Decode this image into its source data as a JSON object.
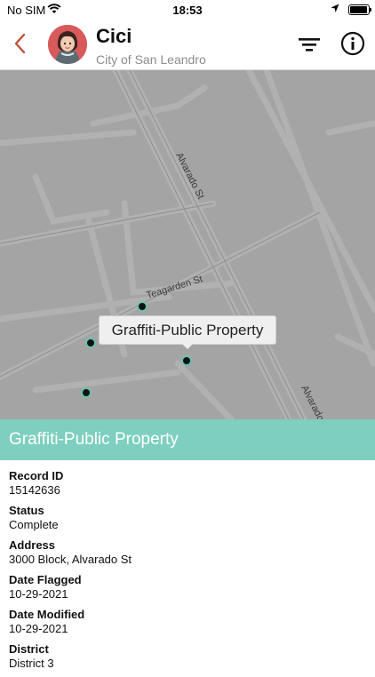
{
  "status_bar": {
    "carrier": "No SIM",
    "time": "18:53"
  },
  "header": {
    "name": "Cici",
    "organization": "City of San Leandro",
    "back_icon": "chevron-left-icon",
    "filter_icon": "filter-icon",
    "info_icon": "info-icon",
    "accent_color": "#c0503a"
  },
  "map": {
    "street_labels": [
      "Alvarado St",
      "Teagarden St",
      "Alvarado St"
    ],
    "tooltip": "Graffiti-Public Property",
    "marker_color": "#0d1513",
    "marker_ring_color": "#6fbfb0"
  },
  "detail": {
    "title": "Graffiti-Public Property",
    "header_color": "#7ecfbf",
    "fields": [
      {
        "label": "Record ID",
        "value": "15142636"
      },
      {
        "label": "Status",
        "value": "Complete"
      },
      {
        "label": "Address",
        "value": "3000 Block, Alvarado St"
      },
      {
        "label": "Date Flagged",
        "value": "10-29-2021"
      },
      {
        "label": "Date Modified",
        "value": "10-29-2021"
      },
      {
        "label": "District",
        "value": "District 3"
      }
    ]
  }
}
